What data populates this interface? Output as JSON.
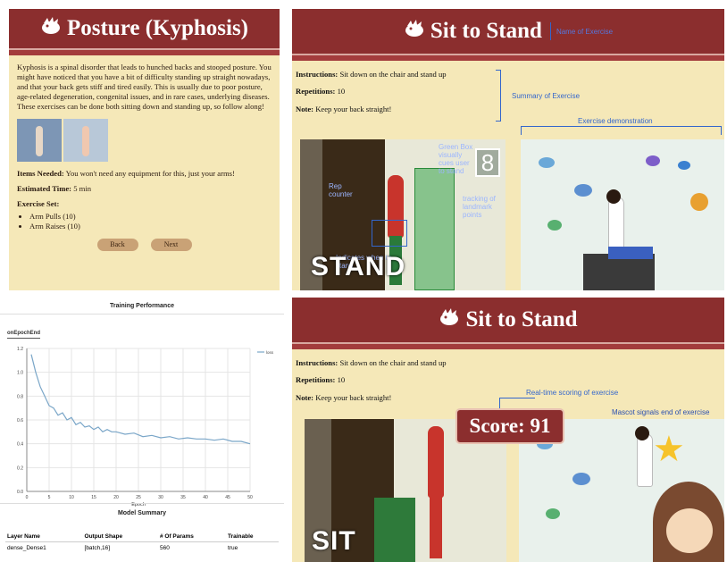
{
  "panel1": {
    "title": "Posture (Kyphosis)",
    "mascot_icon": "hedgehog-icon",
    "description": "Kyphosis is a spinal disorder that leads to hunched backs and stooped posture. You might have noticed that you have a bit of difficulty standing up straight nowadays, and that your back gets stiff and tired easily. This is usually due to poor posture, age-related degeneration, congenital issues, and in rare cases, underlying diseases. These exercises can be done both sitting down and standing up, so follow along!",
    "items_needed_label": "Items Needed:",
    "items_needed_value": "You won't need any equipment for this, just your arms!",
    "time_label": "Estimated Time:",
    "time_value": "5 min",
    "exercise_set_label": "Exercise Set:",
    "exercises": [
      "Arm Pulls (10)",
      "Arm Raises (10)"
    ],
    "back_label": "Back",
    "next_label": "Next"
  },
  "panel2": {
    "title": "Sit to Stand",
    "title_note": "Name of Exercise",
    "instructions_label": "Instructions:",
    "instructions_value": "Sit down on the chair and stand up",
    "repetitions_label": "Repetitions:",
    "repetitions_value": "10",
    "note_label": "Note:",
    "note_value": "Keep your back straight!",
    "annotation_summary": "Summary of Exercise",
    "annotation_demo": "Exercise demonstration",
    "annotation_box": "Green Box visually cues user to stand",
    "annotation_tracking": "tracking of landmark points",
    "annotation_text1": "Rep counter",
    "annotation_text2": "Indicates when to stand",
    "rep_count": "8",
    "pose_label": "STAND"
  },
  "panel3": {
    "title": "Training Performance",
    "tab": "onEpochEnd",
    "legend": "loss",
    "xlabel": "Epoch",
    "table_title": "Model Summary",
    "columns": [
      "Layer Name",
      "Output Shape",
      "# Of Params",
      "Trainable"
    ],
    "rows": [
      [
        "dense_Dense1",
        "[batch,16]",
        "560",
        "true"
      ]
    ]
  },
  "panel4": {
    "title": "Sit to Stand",
    "instructions_label": "Instructions:",
    "instructions_value": "Sit down on the chair and stand up",
    "repetitions_label": "Repetitions:",
    "repetitions_value": "10",
    "note_label": "Note:",
    "note_value": "Keep your back straight!",
    "annotation_score": "Real-time scoring of exercise",
    "annotation_mascot": "Mascot signals end of exercise",
    "score_text": "Score: 91",
    "pose_label": "SIT"
  },
  "chart_data": {
    "type": "line",
    "title": "Training Performance",
    "xlabel": "Epoch",
    "ylabel": "",
    "xlim": [
      0,
      50
    ],
    "ylim": [
      0,
      1.2
    ],
    "x_ticks": [
      0,
      5,
      10,
      15,
      20,
      25,
      30,
      35,
      40,
      45,
      50
    ],
    "y_ticks": [
      0,
      0.2,
      0.4,
      0.6,
      0.8,
      1.0,
      1.2
    ],
    "grid": true,
    "legend_position": "top-right",
    "series": [
      {
        "name": "loss",
        "x": [
          1,
          2,
          3,
          4,
          5,
          6,
          7,
          8,
          9,
          10,
          11,
          12,
          13,
          14,
          15,
          16,
          17,
          18,
          19,
          20,
          22,
          24,
          26,
          28,
          30,
          32,
          34,
          36,
          38,
          40,
          42,
          44,
          46,
          48,
          50
        ],
        "values": [
          1.15,
          1.0,
          0.88,
          0.8,
          0.72,
          0.7,
          0.64,
          0.66,
          0.6,
          0.62,
          0.56,
          0.58,
          0.54,
          0.55,
          0.52,
          0.54,
          0.5,
          0.52,
          0.5,
          0.5,
          0.48,
          0.49,
          0.46,
          0.47,
          0.45,
          0.46,
          0.44,
          0.45,
          0.44,
          0.44,
          0.43,
          0.44,
          0.42,
          0.42,
          0.4
        ]
      }
    ]
  }
}
